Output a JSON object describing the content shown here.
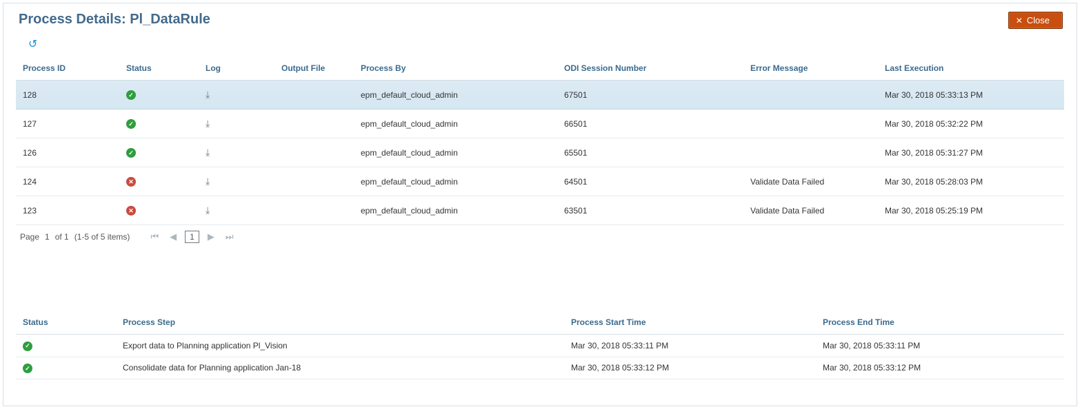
{
  "header": {
    "title": "Process Details: Pl_DataRule",
    "close_label": "Close"
  },
  "columns": {
    "process_id": "Process ID",
    "status": "Status",
    "log": "Log",
    "output_file": "Output File",
    "process_by": "Process By",
    "odi": "ODI Session Number",
    "error": "Error Message",
    "last_exec": "Last Execution"
  },
  "rows": [
    {
      "id": "128",
      "status": "ok",
      "process_by": "epm_default_cloud_admin",
      "odi": "67501",
      "error": "",
      "last_exec": "Mar 30, 2018 05:33:13 PM",
      "selected": true
    },
    {
      "id": "127",
      "status": "ok",
      "process_by": "epm_default_cloud_admin",
      "odi": "66501",
      "error": "",
      "last_exec": "Mar 30, 2018 05:32:22 PM",
      "selected": false
    },
    {
      "id": "126",
      "status": "ok",
      "process_by": "epm_default_cloud_admin",
      "odi": "65501",
      "error": "",
      "last_exec": "Mar 30, 2018 05:31:27 PM",
      "selected": false
    },
    {
      "id": "124",
      "status": "err",
      "process_by": "epm_default_cloud_admin",
      "odi": "64501",
      "error": "Validate Data Failed",
      "last_exec": "Mar 30, 2018 05:28:03 PM",
      "selected": false
    },
    {
      "id": "123",
      "status": "err",
      "process_by": "epm_default_cloud_admin",
      "odi": "63501",
      "error": "Validate Data Failed",
      "last_exec": "Mar 30, 2018 05:25:19 PM",
      "selected": false
    }
  ],
  "pagination": {
    "prefix": "Page",
    "current": "1",
    "of": "of 1",
    "range": "(1-5 of 5 items)"
  },
  "detail_columns": {
    "status": "Status",
    "step": "Process Step",
    "start": "Process Start Time",
    "end": "Process End Time"
  },
  "detail_rows": [
    {
      "status": "ok",
      "step": "Export data to Planning application Pl_Vision",
      "start": "Mar 30, 2018 05:33:11 PM",
      "end": "Mar 30, 2018 05:33:11 PM"
    },
    {
      "status": "ok",
      "step": "Consolidate data for Planning application Jan-18",
      "start": "Mar 30, 2018 05:33:12 PM",
      "end": "Mar 30, 2018 05:33:12 PM"
    }
  ]
}
